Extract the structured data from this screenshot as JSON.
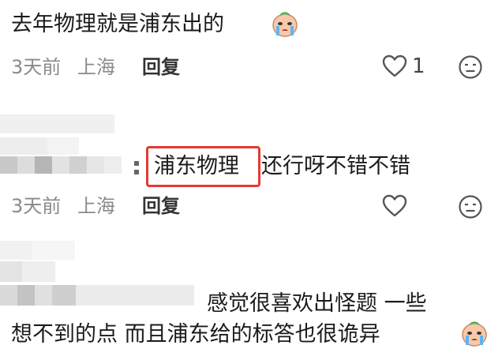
{
  "comments": [
    {
      "text": "去年物理就是浦东出的",
      "emoji": "crying-face-sticker",
      "time": "3天前",
      "location": "上海",
      "reply_label": "回复",
      "like_count": "1"
    },
    {
      "highlight_text": "浦东物理",
      "text_rest": "还行呀不错不错",
      "time": "3天前",
      "location": "上海",
      "reply_label": "回复"
    },
    {
      "line1": "感觉很喜欢出怪题 一些",
      "line2": "想不到的点 而且浦东给的标答也很诡异",
      "emoji": "crying-face-sticker"
    }
  ],
  "colors": {
    "highlight_box": "#e53935",
    "meta_text": "#8a8a8a"
  }
}
